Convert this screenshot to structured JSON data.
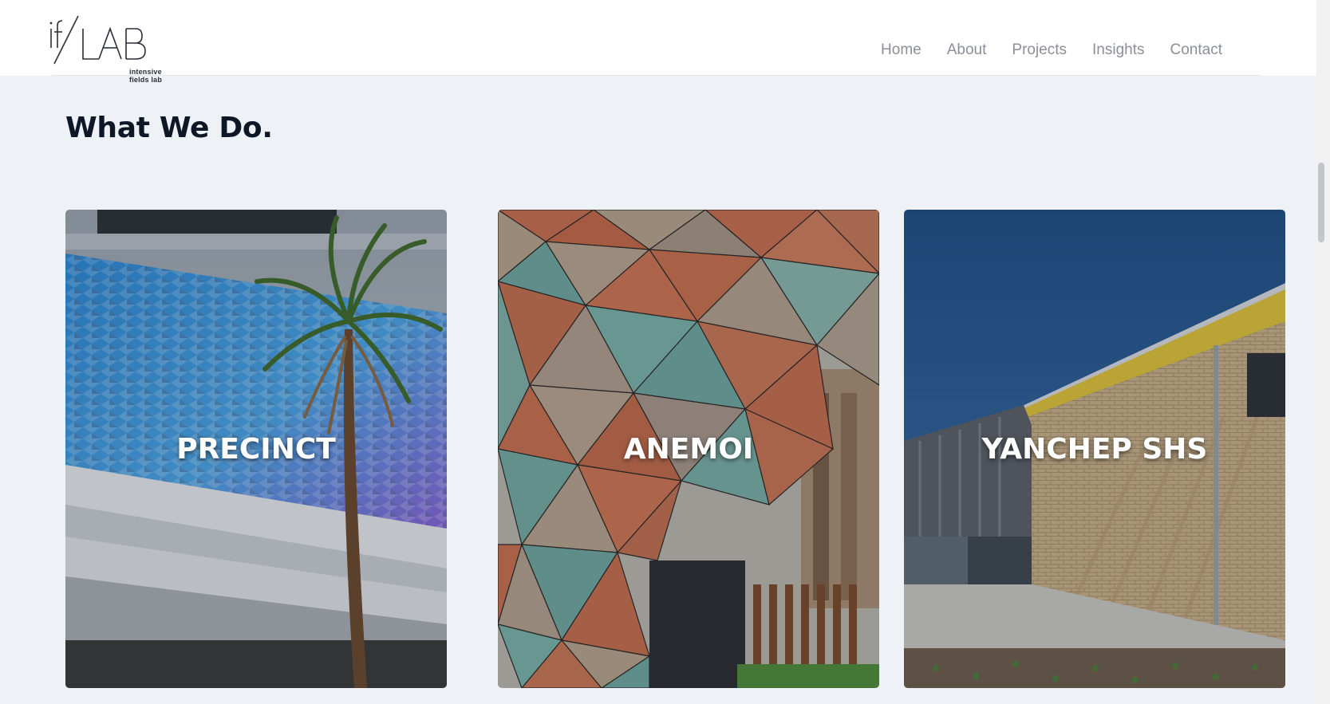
{
  "brand": {
    "logo_mark": "if/LAB",
    "tagline": "intensive fields lab"
  },
  "nav": [
    {
      "label": "Home"
    },
    {
      "label": "About"
    },
    {
      "label": "Projects"
    },
    {
      "label": "Insights"
    },
    {
      "label": "Contact"
    }
  ],
  "section": {
    "title": "What We Do."
  },
  "projects": [
    {
      "title": "PRECINCT",
      "image": "building facade with palm tree"
    },
    {
      "title": "ANEMOI",
      "image": "triangulated panel canopy"
    },
    {
      "title": "YANCHEP SHS",
      "image": "textured brick school building"
    }
  ],
  "colors": {
    "background": "#eef2f7",
    "heading": "#0e1726",
    "nav_text": "#8a8f98",
    "label_text": "#ffffff"
  }
}
